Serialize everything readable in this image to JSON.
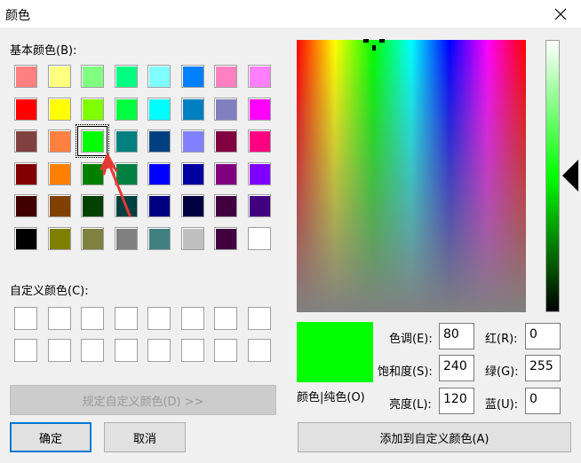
{
  "window": {
    "title": "颜色"
  },
  "labels": {
    "basic_colors": "基本颜色(B):",
    "custom_colors": "自定义颜色(C):",
    "solid_color": "颜色|纯色(O)",
    "hue": "色调(E):",
    "sat": "饱和度(S):",
    "lum": "亮度(L):",
    "red": "红(R):",
    "green": "绿(G):",
    "blue": "蓝(U):"
  },
  "values": {
    "hue": "80",
    "sat": "240",
    "lum": "120",
    "red": "0",
    "green": "255",
    "blue": "0"
  },
  "buttons": {
    "define_custom": "规定自定义颜色(D) >>",
    "ok": "确定",
    "cancel": "取消",
    "add_custom": "添加到自定义颜色(A)"
  },
  "selected_basic_color": "#00ff00",
  "basic_colors": [
    [
      "#ff8080",
      "#ffff80",
      "#80ff80",
      "#00ff80",
      "#80ffff",
      "#0080ff",
      "#ff80c0",
      "#ff80ff"
    ],
    [
      "#ff0000",
      "#ffff00",
      "#80ff00",
      "#00ff40",
      "#00ffff",
      "#0080c0",
      "#8080c0",
      "#ff00ff"
    ],
    [
      "#804040",
      "#ff8040",
      "#00ff00",
      "#008080",
      "#004080",
      "#8080ff",
      "#800040",
      "#ff0080"
    ],
    [
      "#800000",
      "#ff8000",
      "#008000",
      "#008040",
      "#0000ff",
      "#0000a0",
      "#800080",
      "#8000ff"
    ],
    [
      "#400000",
      "#804000",
      "#004000",
      "#004040",
      "#000080",
      "#000040",
      "#400040",
      "#400080"
    ],
    [
      "#000000",
      "#808000",
      "#808040",
      "#808080",
      "#408080",
      "#c0c0c0",
      "#400040",
      "#ffffff"
    ]
  ]
}
